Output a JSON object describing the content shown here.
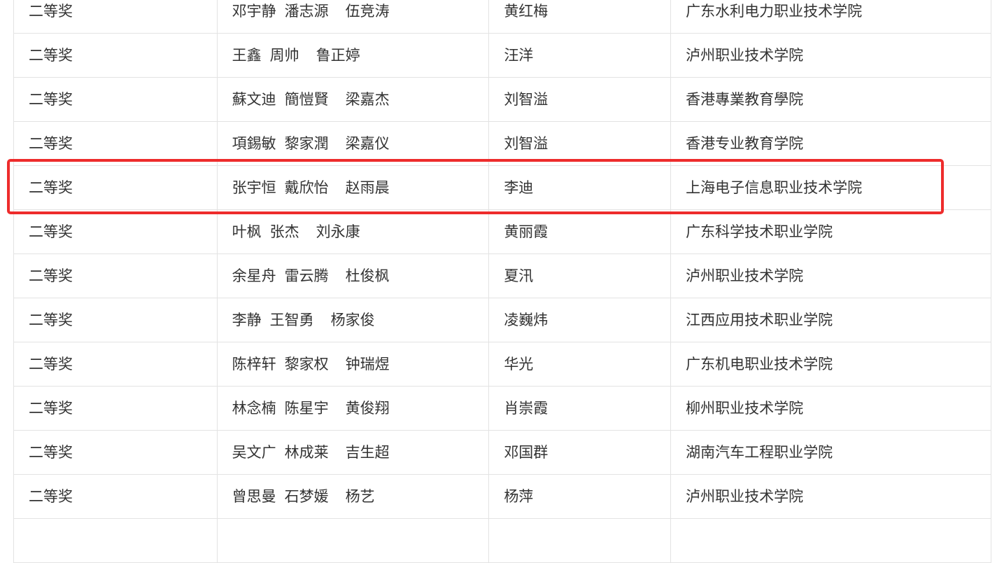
{
  "rows": [
    {
      "award": "二等奖",
      "members": [
        "邓宇静",
        "潘志源",
        "伍竞涛"
      ],
      "advisor": "黄红梅",
      "school": "广东水利电力职业技术学院"
    },
    {
      "award": "二等奖",
      "members": [
        "王鑫",
        "周帅",
        "鲁正婷"
      ],
      "advisor": "汪洋",
      "school": "泸州职业技术学院"
    },
    {
      "award": "二等奖",
      "members": [
        "蘇文迪",
        "簡愷賢",
        "梁嘉杰"
      ],
      "advisor": "刘智溢",
      "school": "香港專業教育學院"
    },
    {
      "award": "二等奖",
      "members": [
        "項錫敏",
        "黎家潤",
        "梁嘉仪"
      ],
      "advisor": "刘智溢",
      "school": "香港专业教育学院"
    },
    {
      "award": "二等奖",
      "members": [
        "张宇恒",
        "戴欣怡",
        "赵雨晨"
      ],
      "advisor": "李迪",
      "school": "上海电子信息职业技术学院",
      "highlighted": true
    },
    {
      "award": "二等奖",
      "members": [
        "叶枫",
        "张杰",
        "刘永康"
      ],
      "advisor": "黄丽霞",
      "school": "广东科学技术职业学院"
    },
    {
      "award": "二等奖",
      "members": [
        "余星舟",
        "雷云腾",
        "杜俊枫"
      ],
      "advisor": "夏汛",
      "school": "泸州职业技术学院"
    },
    {
      "award": "二等奖",
      "members": [
        "李静",
        "王智勇",
        "杨家俊"
      ],
      "advisor": "凌巍炜",
      "school": "江西应用技术职业学院"
    },
    {
      "award": "二等奖",
      "members": [
        "陈梓轩",
        "黎家权",
        "钟瑞煜"
      ],
      "advisor": "华光",
      "school": "广东机电职业技术学院"
    },
    {
      "award": "二等奖",
      "members": [
        "林念楠",
        "陈星宇",
        "黄俊翔"
      ],
      "advisor": "肖崇霞",
      "school": "柳州职业技术学院"
    },
    {
      "award": "二等奖",
      "members": [
        "吴文广",
        "林成莱",
        "吉生超"
      ],
      "advisor": "邓国群",
      "school": "湖南汽车工程职业学院"
    },
    {
      "award": "二等奖",
      "members": [
        "曾思曼",
        "石梦媛",
        "杨艺"
      ],
      "advisor": "杨萍",
      "school": "泸州职业技术学院"
    },
    {
      "award": "",
      "members": [
        "",
        "",
        ""
      ],
      "advisor": "",
      "school": ""
    }
  ],
  "highlight_color": "#ee2c2c",
  "border_color": "#e3e3e3",
  "text_color": "#333333"
}
